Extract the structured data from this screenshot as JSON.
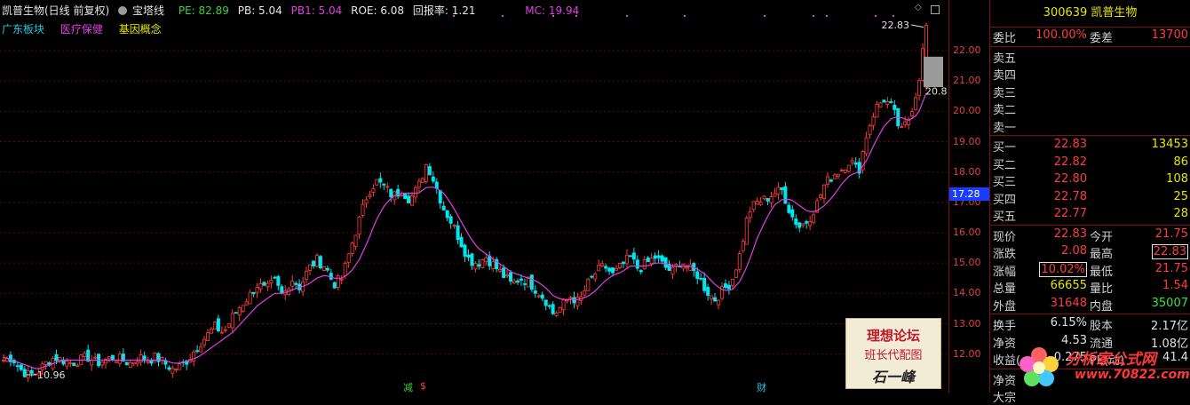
{
  "header": {
    "stock_name": "凯普生物(日线 前复权)",
    "indicator": "宝塔线",
    "pe": "PE: 82.89",
    "pb": "PB: 5.04",
    "pb1": "PB1: 5.04",
    "roe": "ROE: 6.08",
    "report_rate": "回报率: 1.21",
    "mc": "MC: 19.94"
  },
  "concepts": [
    "广东板块",
    "医疗保健",
    "基因概念"
  ],
  "colors": {
    "up": "#ff3c3c",
    "down": "#00e5ee",
    "ma": "#e040e0",
    "axis_red": "#e04040",
    "grid": "#5a0a0a"
  },
  "chart_data": {
    "type": "candlestick",
    "y_ticks": [
      "22.00",
      "21.00",
      "20.00",
      "19.00",
      "18.00",
      "17.00",
      "16.00",
      "15.00",
      "14.00",
      "13.00",
      "12.00"
    ],
    "ylim": [
      11.2,
      23.2
    ],
    "current_price_label": "17.28",
    "max_label": "22.83",
    "min_label": "10.96",
    "right_label": "20.8",
    "bottom_markers": [
      "减",
      "$",
      "财"
    ],
    "close_path": [
      11.8,
      11.9,
      11.5,
      11.3,
      11.4,
      11.7,
      11.9,
      11.8,
      11.7,
      11.8,
      11.9,
      11.7,
      11.8,
      11.9,
      11.8,
      11.7,
      11.9,
      11.8,
      11.9,
      11.7,
      11.5,
      11.6,
      11.9,
      12.3,
      12.6,
      12.9,
      12.7,
      13.2,
      13.6,
      13.9,
      14.3,
      14.1,
      14.4,
      13.9,
      14.5,
      14.2,
      14.8,
      15.1,
      14.9,
      14.3,
      14.5,
      15.5,
      16.4,
      17.3,
      17.7,
      17.5,
      17.2,
      17.4,
      17.1,
      17.5,
      18.3,
      17.6,
      16.8,
      16.3,
      15.7,
      15.1,
      15.0,
      15.2,
      14.9,
      14.6,
      14.3,
      14.5,
      14.4,
      14.1,
      13.8,
      13.3,
      13.6,
      13.9,
      13.7,
      14.3,
      14.7,
      14.9,
      14.6,
      14.9,
      15.2,
      14.8,
      15.0,
      15.2,
      14.9,
      14.7,
      15.1,
      14.8,
      14.6,
      14.1,
      13.8,
      14.1,
      14.4,
      15.3,
      16.7,
      17.0,
      17.1,
      17.3,
      17.4,
      16.6,
      16.2,
      16.4,
      16.9,
      17.6,
      17.9,
      18.1,
      18.4,
      18.0,
      19.3,
      20.1,
      20.4,
      20.1,
      19.3,
      19.8,
      20.8,
      22.83
    ],
    "ma_path": [
      11.9,
      11.8,
      11.7,
      11.6,
      11.5,
      11.6,
      11.7,
      11.8,
      11.8,
      11.8,
      11.8,
      11.8,
      11.8,
      11.8,
      11.8,
      11.8,
      11.8,
      11.8,
      11.8,
      11.8,
      11.7,
      11.7,
      11.8,
      11.9,
      12.1,
      12.3,
      12.5,
      12.7,
      13.0,
      13.3,
      13.6,
      13.8,
      14.0,
      14.0,
      14.1,
      14.2,
      14.3,
      14.5,
      14.6,
      14.5,
      14.5,
      14.7,
      15.1,
      15.7,
      16.4,
      16.9,
      17.2,
      17.3,
      17.3,
      17.3,
      17.5,
      17.5,
      17.3,
      16.9,
      16.4,
      15.9,
      15.5,
      15.3,
      15.1,
      14.9,
      14.7,
      14.6,
      14.5,
      14.4,
      14.2,
      13.9,
      13.8,
      13.8,
      13.8,
      13.9,
      14.1,
      14.4,
      14.6,
      14.7,
      14.9,
      14.9,
      14.9,
      15.0,
      15.0,
      14.9,
      14.9,
      14.9,
      14.8,
      14.6,
      14.3,
      14.1,
      14.1,
      14.4,
      15.0,
      15.8,
      16.4,
      16.9,
      17.1,
      17.1,
      16.9,
      16.7,
      16.7,
      16.9,
      17.2,
      17.6,
      17.9,
      18.0,
      18.4,
      19.0,
      19.5,
      19.8,
      19.8,
      19.7,
      19.9,
      20.6
    ]
  },
  "panel": {
    "code": "300639",
    "name": "凯普生物",
    "weibi_label": "委比",
    "weibi_value": "100.00%",
    "weicha_label": "委差",
    "weicha_value": "13700",
    "asks": [
      {
        "label": "卖五",
        "price": "",
        "vol": ""
      },
      {
        "label": "卖四",
        "price": "",
        "vol": ""
      },
      {
        "label": "卖三",
        "price": "",
        "vol": ""
      },
      {
        "label": "卖二",
        "price": "",
        "vol": ""
      },
      {
        "label": "卖一",
        "price": "",
        "vol": ""
      }
    ],
    "bids": [
      {
        "label": "买一",
        "price": "22.83",
        "vol": "13453"
      },
      {
        "label": "买二",
        "price": "22.82",
        "vol": "86"
      },
      {
        "label": "买三",
        "price": "22.80",
        "vol": "108"
      },
      {
        "label": "买四",
        "price": "22.78",
        "vol": "25"
      },
      {
        "label": "买五",
        "price": "22.77",
        "vol": "28"
      }
    ],
    "quote": [
      {
        "l1": "现价",
        "v1": "22.83",
        "c1": "red",
        "l2": "今开",
        "v2": "21.75",
        "c2": "red"
      },
      {
        "l1": "涨跌",
        "v1": "2.08",
        "c1": "red",
        "l2": "最高",
        "v2": "22.83",
        "c2": "red",
        "box2": true
      },
      {
        "l1": "涨幅",
        "v1": "10.02%",
        "c1": "red",
        "box1": true,
        "l2": "最低",
        "v2": "21.75",
        "c2": "red"
      },
      {
        "l1": "总量",
        "v1": "66655",
        "c1": "yellow",
        "l2": "量比",
        "v2": "1.54",
        "c2": "red"
      },
      {
        "l1": "外盘",
        "v1": "31648",
        "c1": "red",
        "l2": "内盘",
        "v2": "35007",
        "c2": "green"
      }
    ],
    "fundamentals": [
      {
        "l1": "换手",
        "v1": "6.15%",
        "l2": "股本",
        "v2": "2.17亿"
      },
      {
        "l1": "净资",
        "v1": "4.53",
        "l2": "流通",
        "v2": "1.08亿"
      },
      {
        "l1": "收益(一)",
        "v1": "0.275",
        "l2": "PE(动)",
        "v2": "41.4"
      }
    ],
    "partial_rows": [
      "净资",
      "大宗"
    ]
  },
  "stamp": {
    "line1": "理想论坛",
    "line2": "班长代配图",
    "signature": "石一峰"
  },
  "watermark": {
    "name": "分析家公式网",
    "url": "www.70822.com"
  }
}
